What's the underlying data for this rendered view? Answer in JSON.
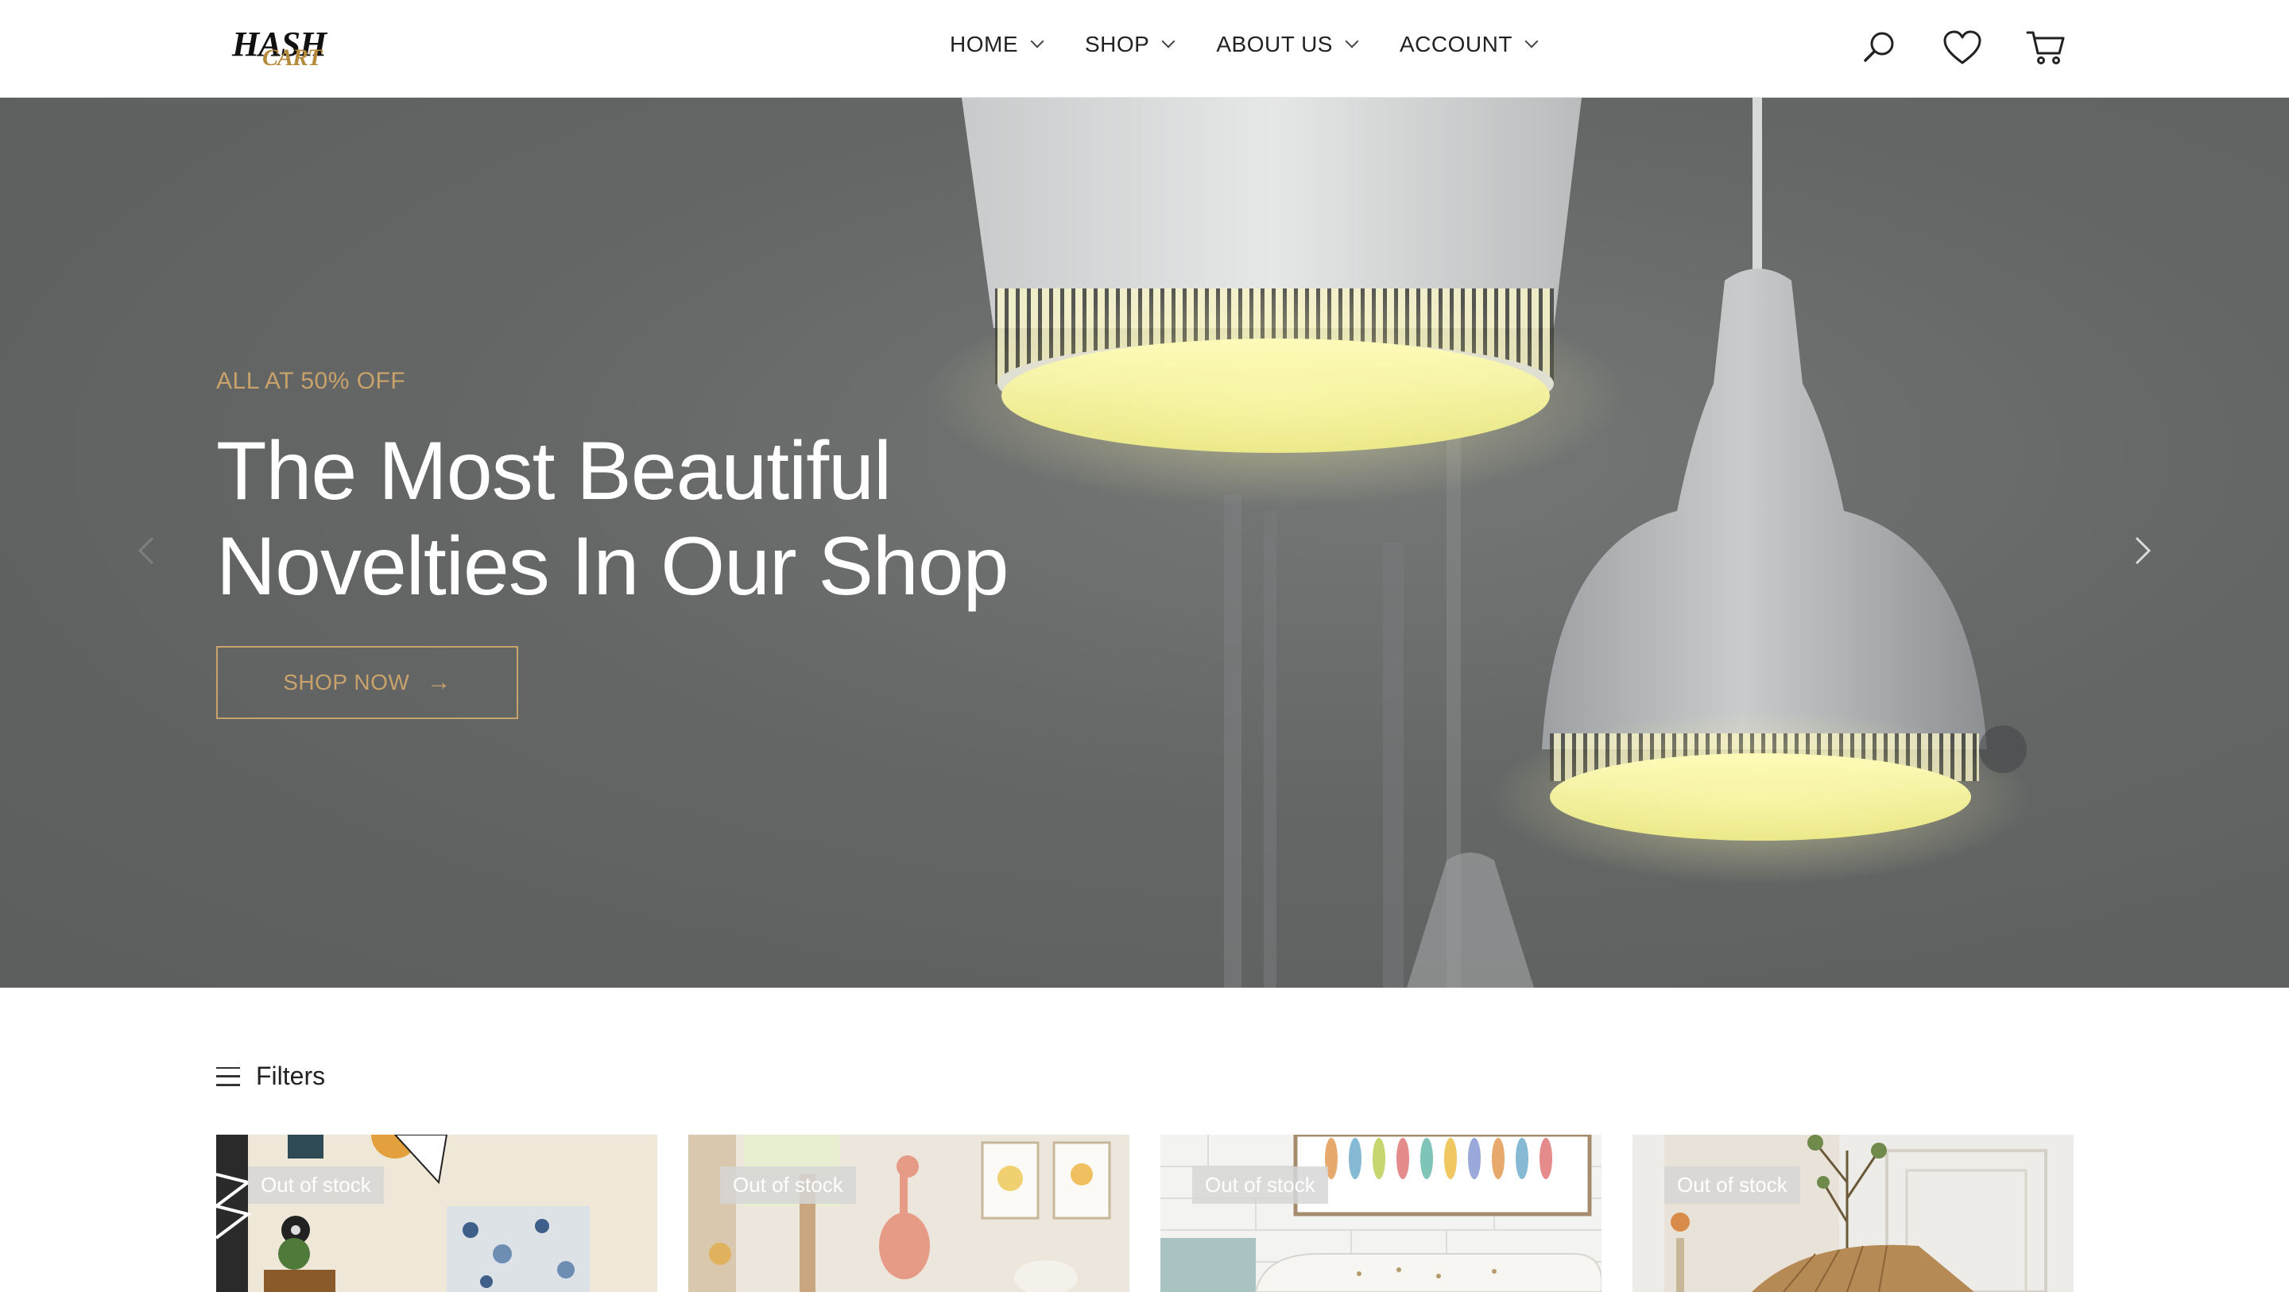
{
  "header": {
    "logo_line1": "HASH",
    "logo_line2": "CART",
    "nav": [
      {
        "label": "HOME"
      },
      {
        "label": "SHOP"
      },
      {
        "label": "ABOUT US"
      },
      {
        "label": "ACCOUNT"
      }
    ],
    "icons": [
      "search-icon",
      "heart-icon",
      "cart-icon"
    ]
  },
  "hero": {
    "eyebrow": "ALL AT 50% OFF",
    "headline_line1": "The Most Beautiful",
    "headline_line2": "Novelties In Our Shop",
    "cta_label": "SHOP NOW",
    "cta_arrow": "→",
    "accent_color": "#c8a26a"
  },
  "filters": {
    "label": "Filters"
  },
  "products": [
    {
      "badge": "Out of stock"
    },
    {
      "badge": "Out of stock"
    },
    {
      "badge": "Out of stock"
    },
    {
      "badge": "Out of stock"
    }
  ]
}
